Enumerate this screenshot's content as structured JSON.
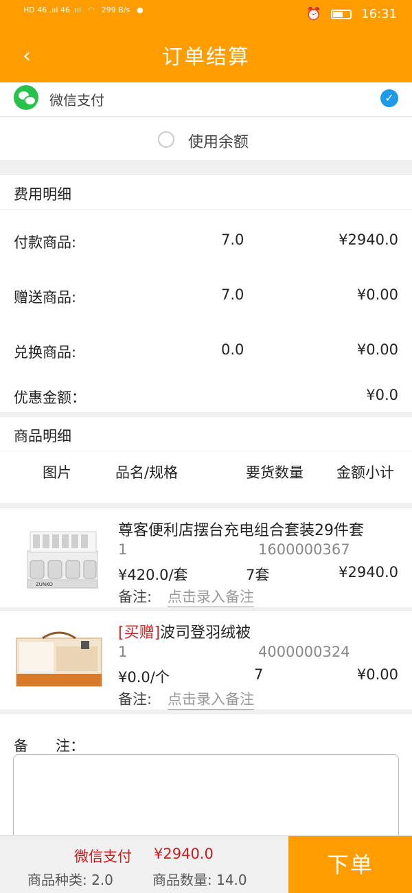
{
  "status_bar": {
    "signal_left": "HD 46 .ııl 46 .ııl",
    "speed": "299 B/s",
    "time": "16:31"
  },
  "header": {
    "title": "订单结算",
    "back_icon": "chevron-left-icon"
  },
  "payment": {
    "wechat_label": "微信支付",
    "wechat_selected": true,
    "balance_label": "使用余额",
    "balance_selected": false
  },
  "fees": {
    "section_title": "费用明细",
    "rows": [
      {
        "label": "付款商品:",
        "qty": "7.0",
        "amount": "¥2940.0"
      },
      {
        "label": "赠送商品:",
        "qty": "7.0",
        "amount": "¥0.00"
      },
      {
        "label": "兑换商品:",
        "qty": "0.0",
        "amount": "¥0.00"
      },
      {
        "label": "优惠金额：",
        "qty": "",
        "amount": "¥0.0"
      }
    ]
  },
  "goods": {
    "section_title": "商品明细",
    "columns": [
      "图片",
      "品名/规格",
      "要货数量",
      "金额小计"
    ],
    "items": [
      {
        "gift_tag": "",
        "name": "尊客便利店摆台充电组合套装29件套",
        "line_qty": "1",
        "code": "1600000367",
        "unit_price": "¥420.0/套",
        "count": "7套",
        "subtotal": "¥2940.0",
        "note_label": "备注:",
        "note_link": "点击录入备注"
      },
      {
        "gift_tag": "[买赠]",
        "name": "波司登羽绒被",
        "line_qty": "1",
        "code": "4000000324",
        "unit_price": "¥0.0/个",
        "count": "7",
        "subtotal": "¥0.00",
        "note_label": "备注:",
        "note_link": "点击录入备注"
      }
    ]
  },
  "remark": {
    "label": "备    注：",
    "value": ""
  },
  "footer": {
    "pay_method": "微信支付",
    "total": "¥2940.0",
    "kinds": "商品种类: 2.0",
    "quantity": "商品数量: 14.0",
    "submit": "下单"
  },
  "colors": {
    "accent": "#ff9c00",
    "price_red": "#c81e1e",
    "check_blue": "#1f9ae8",
    "wechat_green": "#27c24c"
  }
}
